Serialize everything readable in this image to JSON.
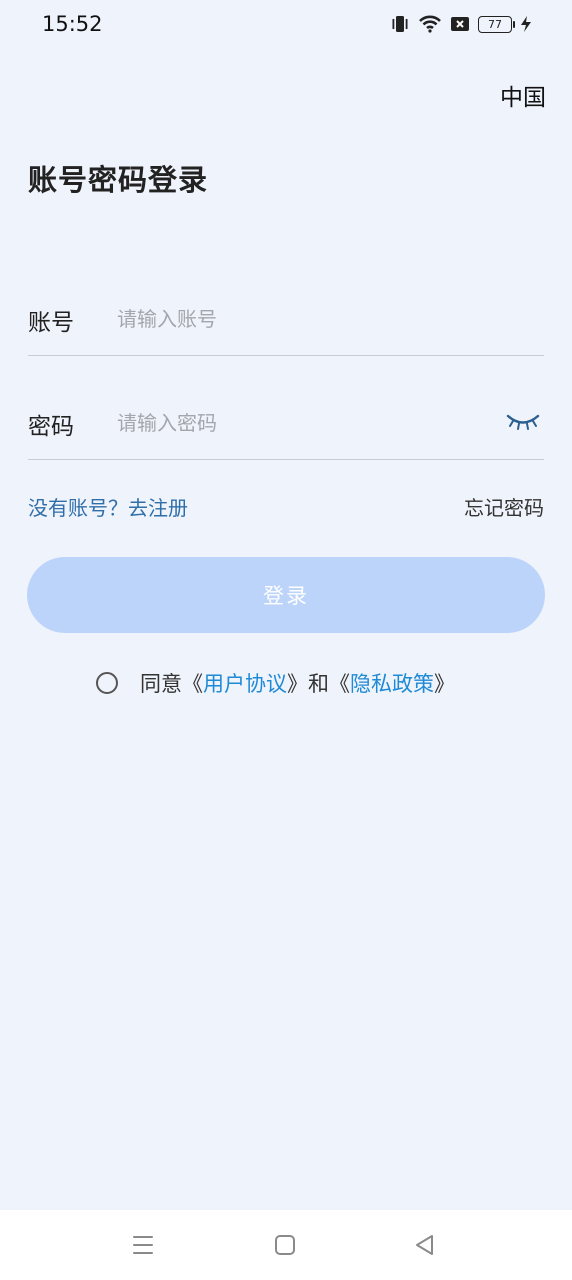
{
  "status_bar": {
    "time": "15:52",
    "battery": "77",
    "icons": [
      "vibrate-icon",
      "wifi-icon",
      "sim-off-icon",
      "battery-icon",
      "charging-icon"
    ]
  },
  "header": {
    "region": "中国",
    "title": "账号密码登录"
  },
  "form": {
    "account_label": "账号",
    "account_placeholder": "请输入账号",
    "account_value": "",
    "password_label": "密码",
    "password_placeholder": "请输入密码",
    "password_value": ""
  },
  "links": {
    "register": "没有账号？去注册",
    "forgot": "忘记密码"
  },
  "login_button": "登录",
  "agreement": {
    "prefix": "同意《",
    "user_agreement": "用户协议",
    "middle": "》和《",
    "privacy_policy": "隐私政策",
    "suffix": "》"
  },
  "colors": {
    "background": "#eff3fb",
    "accent_link": "#1f8ad6",
    "register_link": "#2f6ea9",
    "button_disabled": "#bcd3fa"
  }
}
